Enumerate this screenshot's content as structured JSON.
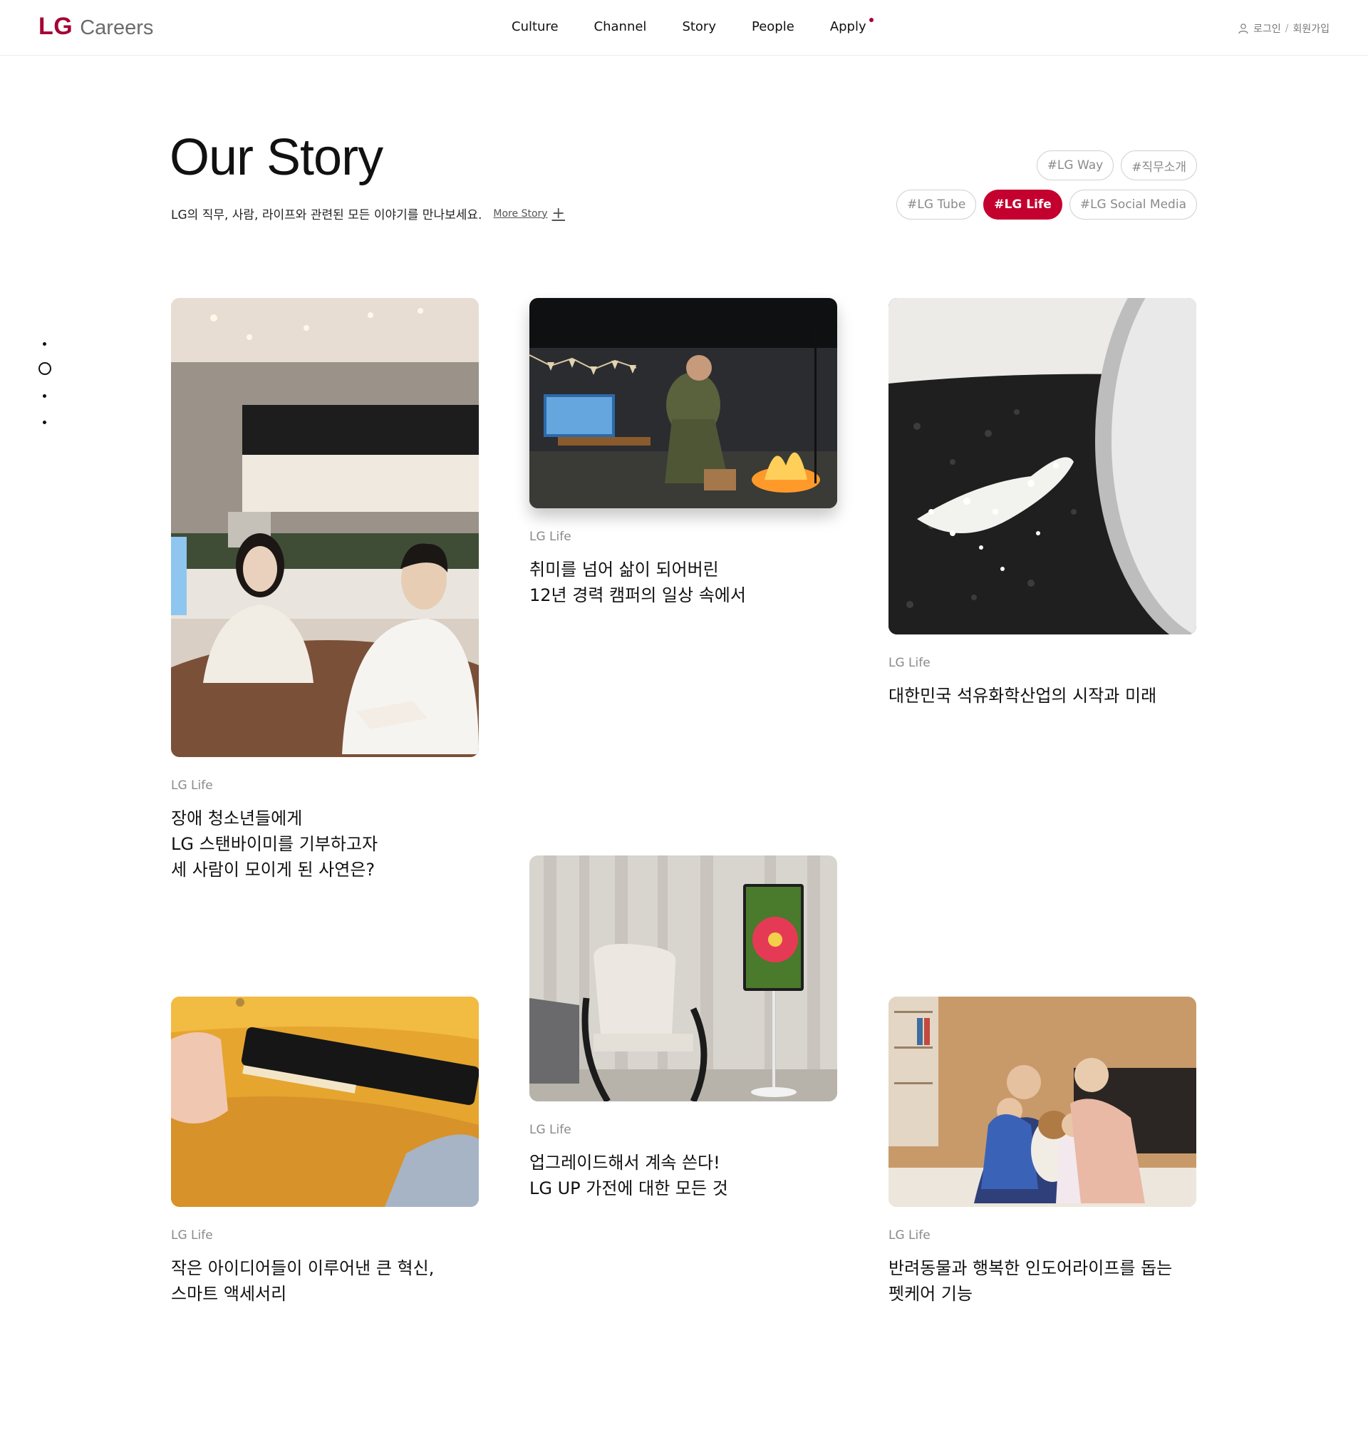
{
  "header": {
    "logo_mark": "LG",
    "logo_text": "Careers",
    "nav": [
      "Culture",
      "Channel",
      "Story",
      "People",
      "Apply"
    ],
    "login": "로그인",
    "signup": "회원가입",
    "auth_sep": "/"
  },
  "hero": {
    "title": "Our Story",
    "subtitle": "LG의 직무, 사람, 라이프와 관련된 모든 이야기를 만나보세요.",
    "more": "More Story",
    "tags_row1": [
      "#LG Way",
      "#직무소개"
    ],
    "tags_row2": [
      "#LG Tube",
      "#LG Life",
      "#LG Social Media"
    ],
    "active_tag": "#LG Life"
  },
  "accent_color": "#a50034",
  "active_tag_color": "#c4002f",
  "cards": [
    {
      "category": "LG Life",
      "title": "장애 청소년들에게\nLG 스탠바이미를 기부하고자\n세 사람이 모이게 된 사연은?",
      "image": "kitchen-interview-photo"
    },
    {
      "category": "LG Life",
      "title": "취미를 넘어 삶이 되어버린\n12년 경력 캠퍼의 일상 속에서",
      "image": "night-camping-photo"
    },
    {
      "category": "LG Life",
      "title": "대한민국 석유화학산업의 시작과 미래",
      "image": "petrochemical-pellets-photo"
    },
    {
      "category": "LG Life",
      "title": "작은 아이디어들이 이루어낸 큰 혁신,\n스마트 액세서리",
      "image": "yellow-bag-accessory-photo"
    },
    {
      "category": "LG Life",
      "title": "업그레이드해서 계속 쓴다!\nLG UP 가전에 대한 모든 것",
      "image": "standbyme-chair-photo"
    },
    {
      "category": "LG Life",
      "title": "반려동물과 행복한 인도어라이프를 돕는\n펫케어 기능",
      "image": "family-with-dog-photo"
    }
  ]
}
